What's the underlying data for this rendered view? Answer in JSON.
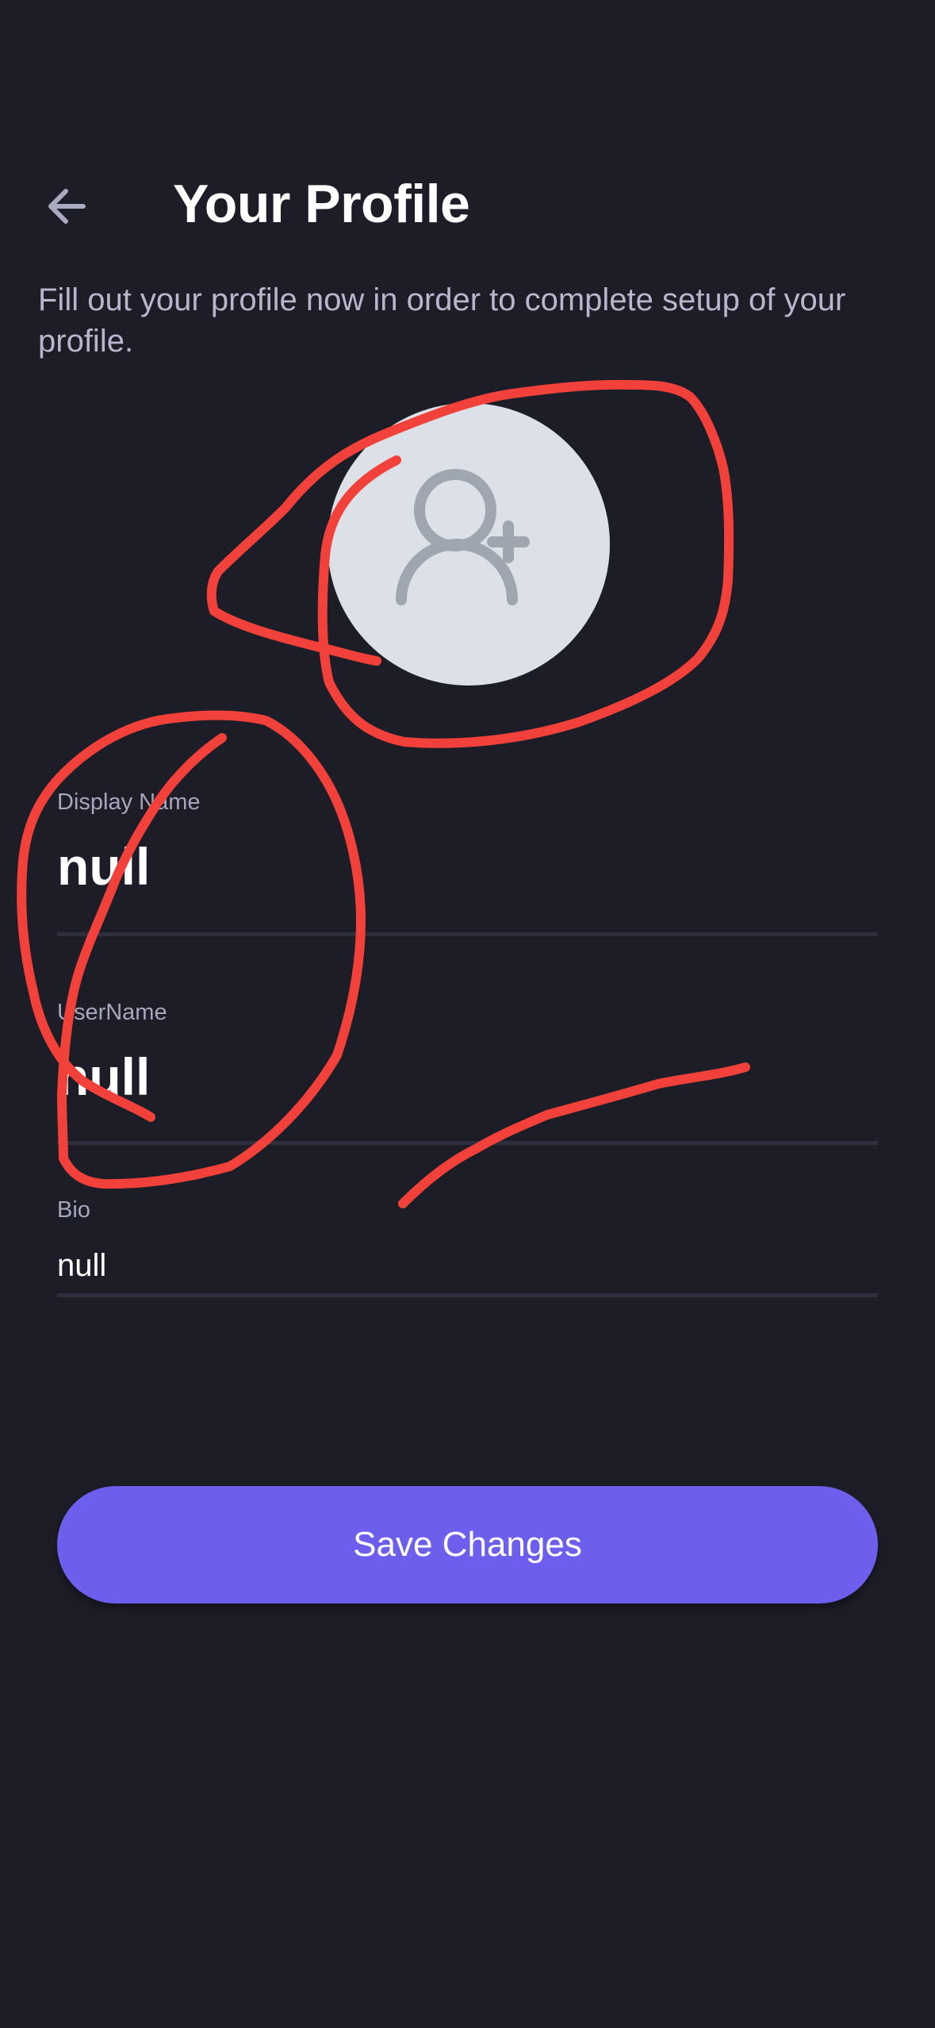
{
  "header": {
    "title": "Your Profile",
    "back_icon": "arrow-left-icon"
  },
  "subtitle": "Fill out your profile now in order to complete setup of your profile.",
  "avatar": {
    "icon": "user-add-icon"
  },
  "fields": {
    "display_name": {
      "label": "Display Name",
      "value": "null"
    },
    "username": {
      "label": "UserName",
      "value": "null"
    },
    "bio": {
      "label": "Bio",
      "value": "null"
    }
  },
  "save_button": {
    "label": "Save Changes"
  },
  "colors": {
    "background": "#1c1d26",
    "accent": "#6c5fed",
    "annotation": "#f2413a"
  }
}
